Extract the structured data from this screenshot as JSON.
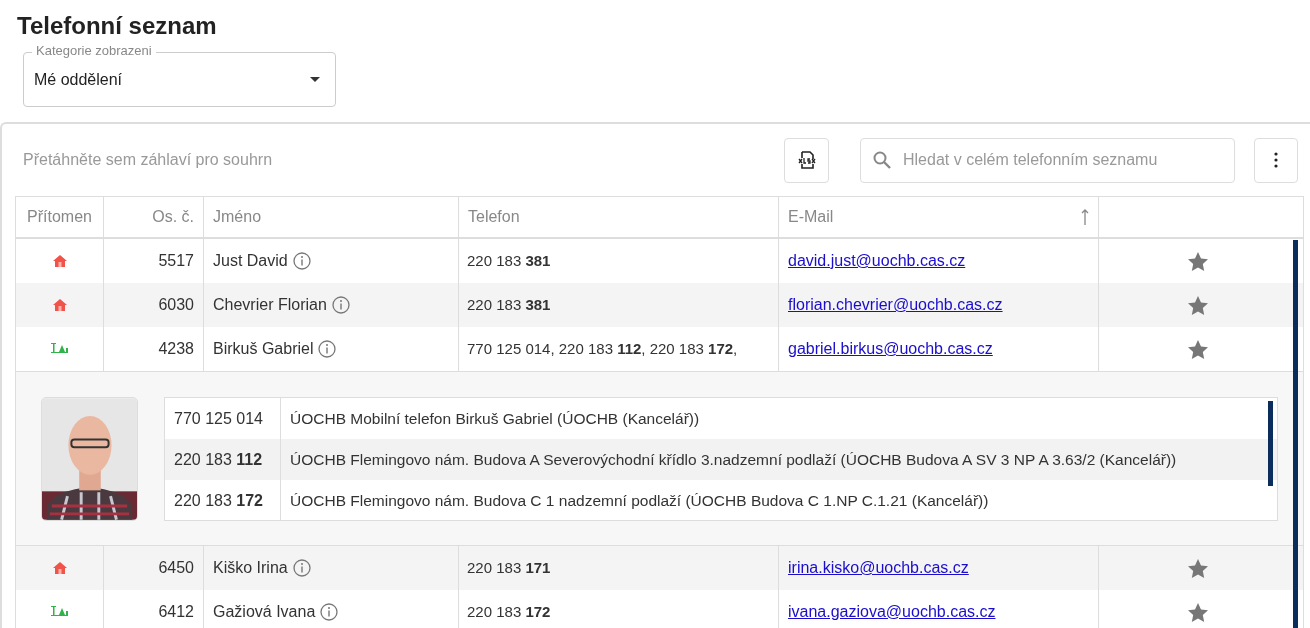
{
  "title": "Telefonní seznam",
  "category_select": {
    "label": "Kategorie zobrazeni",
    "value": "Mé oddělení"
  },
  "toolbar": {
    "group_panel_hint": "Přetáhněte sem záhlaví pro souhrn",
    "search": {
      "placeholder": "Hledat v celém telefonním seznamu"
    }
  },
  "table": {
    "columns": [
      {
        "label": "Přítomen",
        "sorted": false
      },
      {
        "label": "Os. č.",
        "sorted": false
      },
      {
        "label": "Jméno",
        "sorted": false
      },
      {
        "label": "Telefon",
        "sorted": false
      },
      {
        "label": "E-Mail",
        "sorted": true
      }
    ],
    "rows": [
      {
        "kind": "home",
        "number": "5517",
        "name": "Just David",
        "phone": "220 183 **381**",
        "email": "david.just@uochb.cas.cz"
      },
      {
        "kind": "home",
        "number": "6030",
        "name": "Chevrier Florian",
        "phone": "220 183 **381**",
        "email": "florian.chevrier@uochb.cas.cz"
      },
      {
        "kind": "office",
        "number": "4238",
        "name": "Birkuš Gabriel",
        "phone": "770 125 014, 220 183 **112**, 220 183 **172**,",
        "email": "gabriel.birkus@uochb.cas.cz",
        "detail": {
          "phones": [
            {
              "number": "770 125 014",
              "description": "ÚOCHB Mobilní telefon Birkuš Gabriel (ÚOCHB (Kancelář))"
            },
            {
              "number": "220 183 **112**",
              "description": "ÚOCHB Flemingovo nám. Budova A Severovýchodní křídlo 3.nadzemní podlaží (ÚOCHB Budova A SV 3 NP A 3.63/2 (Kancelář))"
            },
            {
              "number": "220 183 **172**",
              "description": "ÚOCHB Flemingovo nám. Budova C 1 nadzemní podlaží (ÚOCHB Budova C 1.NP C.1.21 (Kancelář))"
            }
          ]
        }
      },
      {
        "kind": "home",
        "number": "6450",
        "name": "Kiško Irina",
        "phone": "220 183 **171**",
        "email": "irina.kisko@uochb.cas.cz"
      },
      {
        "kind": "office",
        "number": "6412",
        "name": "Gažiová Ivana",
        "phone": "220 183 **172**",
        "email": "ivana.gaziova@uochb.cas.cz"
      }
    ]
  }
}
